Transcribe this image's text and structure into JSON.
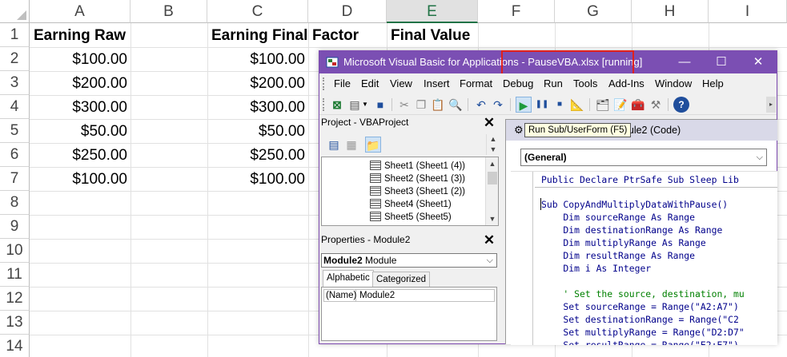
{
  "sheet": {
    "columns": [
      "A",
      "B",
      "C",
      "D",
      "E",
      "F",
      "G",
      "H",
      "I"
    ],
    "selected_column": "E",
    "rows": [
      "1",
      "2",
      "3",
      "4",
      "5",
      "6",
      "7",
      "8",
      "9",
      "10",
      "11",
      "12",
      "13",
      "14"
    ],
    "headers": {
      "a1": "Earning Raw",
      "c1": "Earning Final",
      "d1": "Factor",
      "e1": "Final Value"
    },
    "col_a": [
      "$100.00",
      "$200.00",
      "$300.00",
      "$50.00",
      "$250.00",
      "$100.00"
    ],
    "col_c": [
      "$100.00",
      "$200.00",
      "$300.00",
      "$50.00",
      "$250.00",
      "$100.00"
    ]
  },
  "vbe": {
    "title_prefix": "Microsoft Visual Basic for Applications",
    "title_suffix": " - PauseVBA.xlsx [running]",
    "accent_color": "#7b4fb3",
    "highlight_color": "#e0201c",
    "window_buttons": {
      "minimize": "—",
      "maximize": "☐",
      "close": "✕"
    },
    "menu": [
      "File",
      "Edit",
      "View",
      "Insert",
      "Format",
      "Debug",
      "Run",
      "Tools",
      "Add-Ins",
      "Window",
      "Help"
    ],
    "tooltip": "Run Sub/UserForm (F5)",
    "project": {
      "title": "Project - VBAProject",
      "close": "✕",
      "items": [
        "Sheet1 (Sheet1 (4))",
        "Sheet2 (Sheet1 (3))",
        "Sheet3 (Sheet1 (2))",
        "Sheet4 (Sheet1)",
        "Sheet5 (Sheet5)"
      ]
    },
    "properties": {
      "title": "Properties - Module2",
      "close": "✕",
      "object_name": "Module2",
      "object_type": "Module",
      "tabs": [
        "Alphabetic",
        "Categorized"
      ],
      "row_key": "(Name)",
      "row_value": "Module2"
    },
    "code": {
      "title": "PauseVBA.xlsx - Module2 (Code)",
      "procedure_combo": "(General)",
      "declaration": "Public Declare PtrSafe Sub Sleep Lib",
      "lines": [
        "Sub CopyAndMultiplyDataWithPause()",
        "    Dim sourceRange As Range",
        "    Dim destinationRange As Range",
        "    Dim multiplyRange As Range",
        "    Dim resultRange As Range",
        "    Dim i As Integer",
        "",
        "    ' Set the source, destination, mu",
        "    Set sourceRange = Range(\"A2:A7\")",
        "    Set destinationRange = Range(\"C2",
        "    Set multiplyRange = Range(\"D2:D7\"",
        "    Set resultRange = Range(\"E2:E7\")"
      ]
    }
  }
}
